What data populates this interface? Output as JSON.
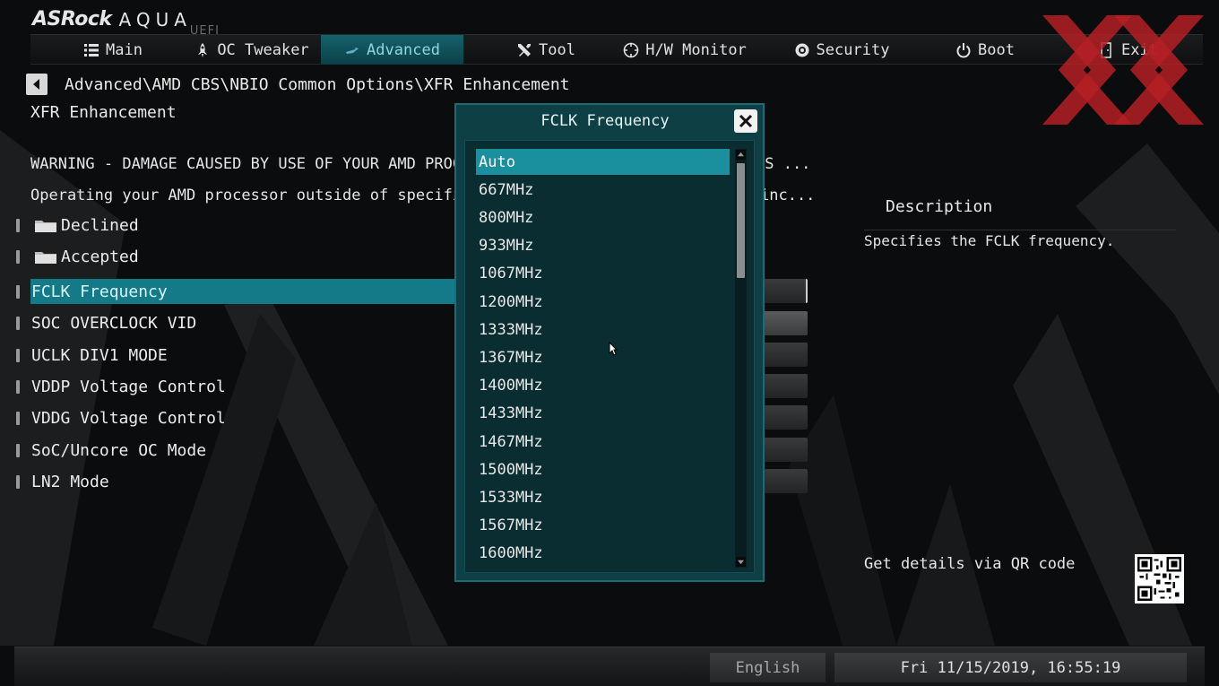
{
  "brand": {
    "name": "ASRock",
    "product": "AQUA",
    "suffix": "UEFI"
  },
  "nav": {
    "tabs": [
      {
        "label": "Main",
        "icon": "list-icon"
      },
      {
        "label": "OC Tweaker",
        "icon": "rocket-icon"
      },
      {
        "label": "Advanced",
        "icon": "star-icon",
        "active": true
      },
      {
        "label": "Tool",
        "icon": "tools-icon"
      },
      {
        "label": "H/W Monitor",
        "icon": "monitor-icon"
      },
      {
        "label": "Security",
        "icon": "shield-icon"
      },
      {
        "label": "Boot",
        "icon": "power-icon"
      },
      {
        "label": "Exit",
        "icon": "exit-icon"
      }
    ]
  },
  "breadcrumb": "Advanced\\AMD CBS\\NBIO Common Options\\XFR Enhancement",
  "page_title": "XFR Enhancement",
  "warnings": [
    {
      "start": "WARNING - DAMAGE CAUSED BY USE OF YOUR AMD PROCESSOR",
      "tail": "SS ..."
    },
    {
      "start": "Operating your AMD processor outside of specificatio",
      "tail": "inc..."
    }
  ],
  "folders": [
    {
      "label": "Declined"
    },
    {
      "label": "Accepted"
    }
  ],
  "settings": [
    {
      "label": "FCLK Frequency",
      "selected": true
    },
    {
      "label": "SOC OVERCLOCK VID"
    },
    {
      "label": "UCLK DIV1 MODE"
    },
    {
      "label": "VDDP Voltage Control"
    },
    {
      "label": "VDDG Voltage Control"
    },
    {
      "label": "SoC/Uncore OC Mode"
    },
    {
      "label": "LN2 Mode"
    }
  ],
  "description": {
    "title": "Description",
    "text": "Specifies the FCLK frequency.",
    "qr_text": "Get details via QR code"
  },
  "modal": {
    "title": "FCLK Frequency",
    "selected_index": 0,
    "options": [
      "Auto",
      "667MHz",
      "800MHz",
      "933MHz",
      "1067MHz",
      "1200MHz",
      "1333MHz",
      "1367MHz",
      "1400MHz",
      "1433MHz",
      "1467MHz",
      "1500MHz",
      "1533MHz",
      "1567MHz",
      "1600MHz"
    ]
  },
  "footer": {
    "language": "English",
    "datetime": "Fri 11/15/2019, 16:55:19"
  },
  "colors": {
    "accent": "#147a88",
    "modal_bg": "#0d3f45",
    "watermark": "#b52025"
  }
}
